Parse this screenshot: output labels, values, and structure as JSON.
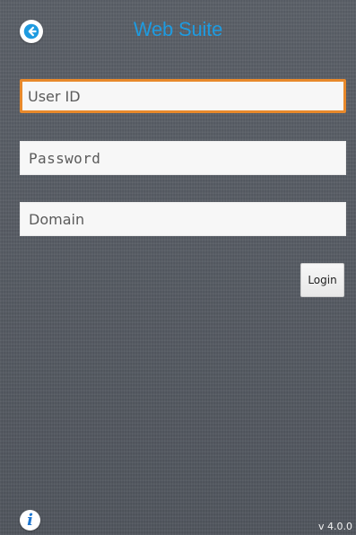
{
  "header": {
    "title": "Web Suite"
  },
  "form": {
    "user_id": {
      "placeholder": "User ID",
      "value": ""
    },
    "password": {
      "placeholder": "Password",
      "value": ""
    },
    "domain": {
      "placeholder": "Domain",
      "value": ""
    },
    "login_label": "Login"
  },
  "footer": {
    "info_icon_label": "i",
    "version": "v 4.0.0"
  },
  "icons": {
    "back": "back-arrow-icon",
    "info": "info-icon"
  },
  "colors": {
    "title": "#1e9be0",
    "focus_border": "#e8892b",
    "background": "#585d65",
    "info_icon": "#1f77d0"
  }
}
